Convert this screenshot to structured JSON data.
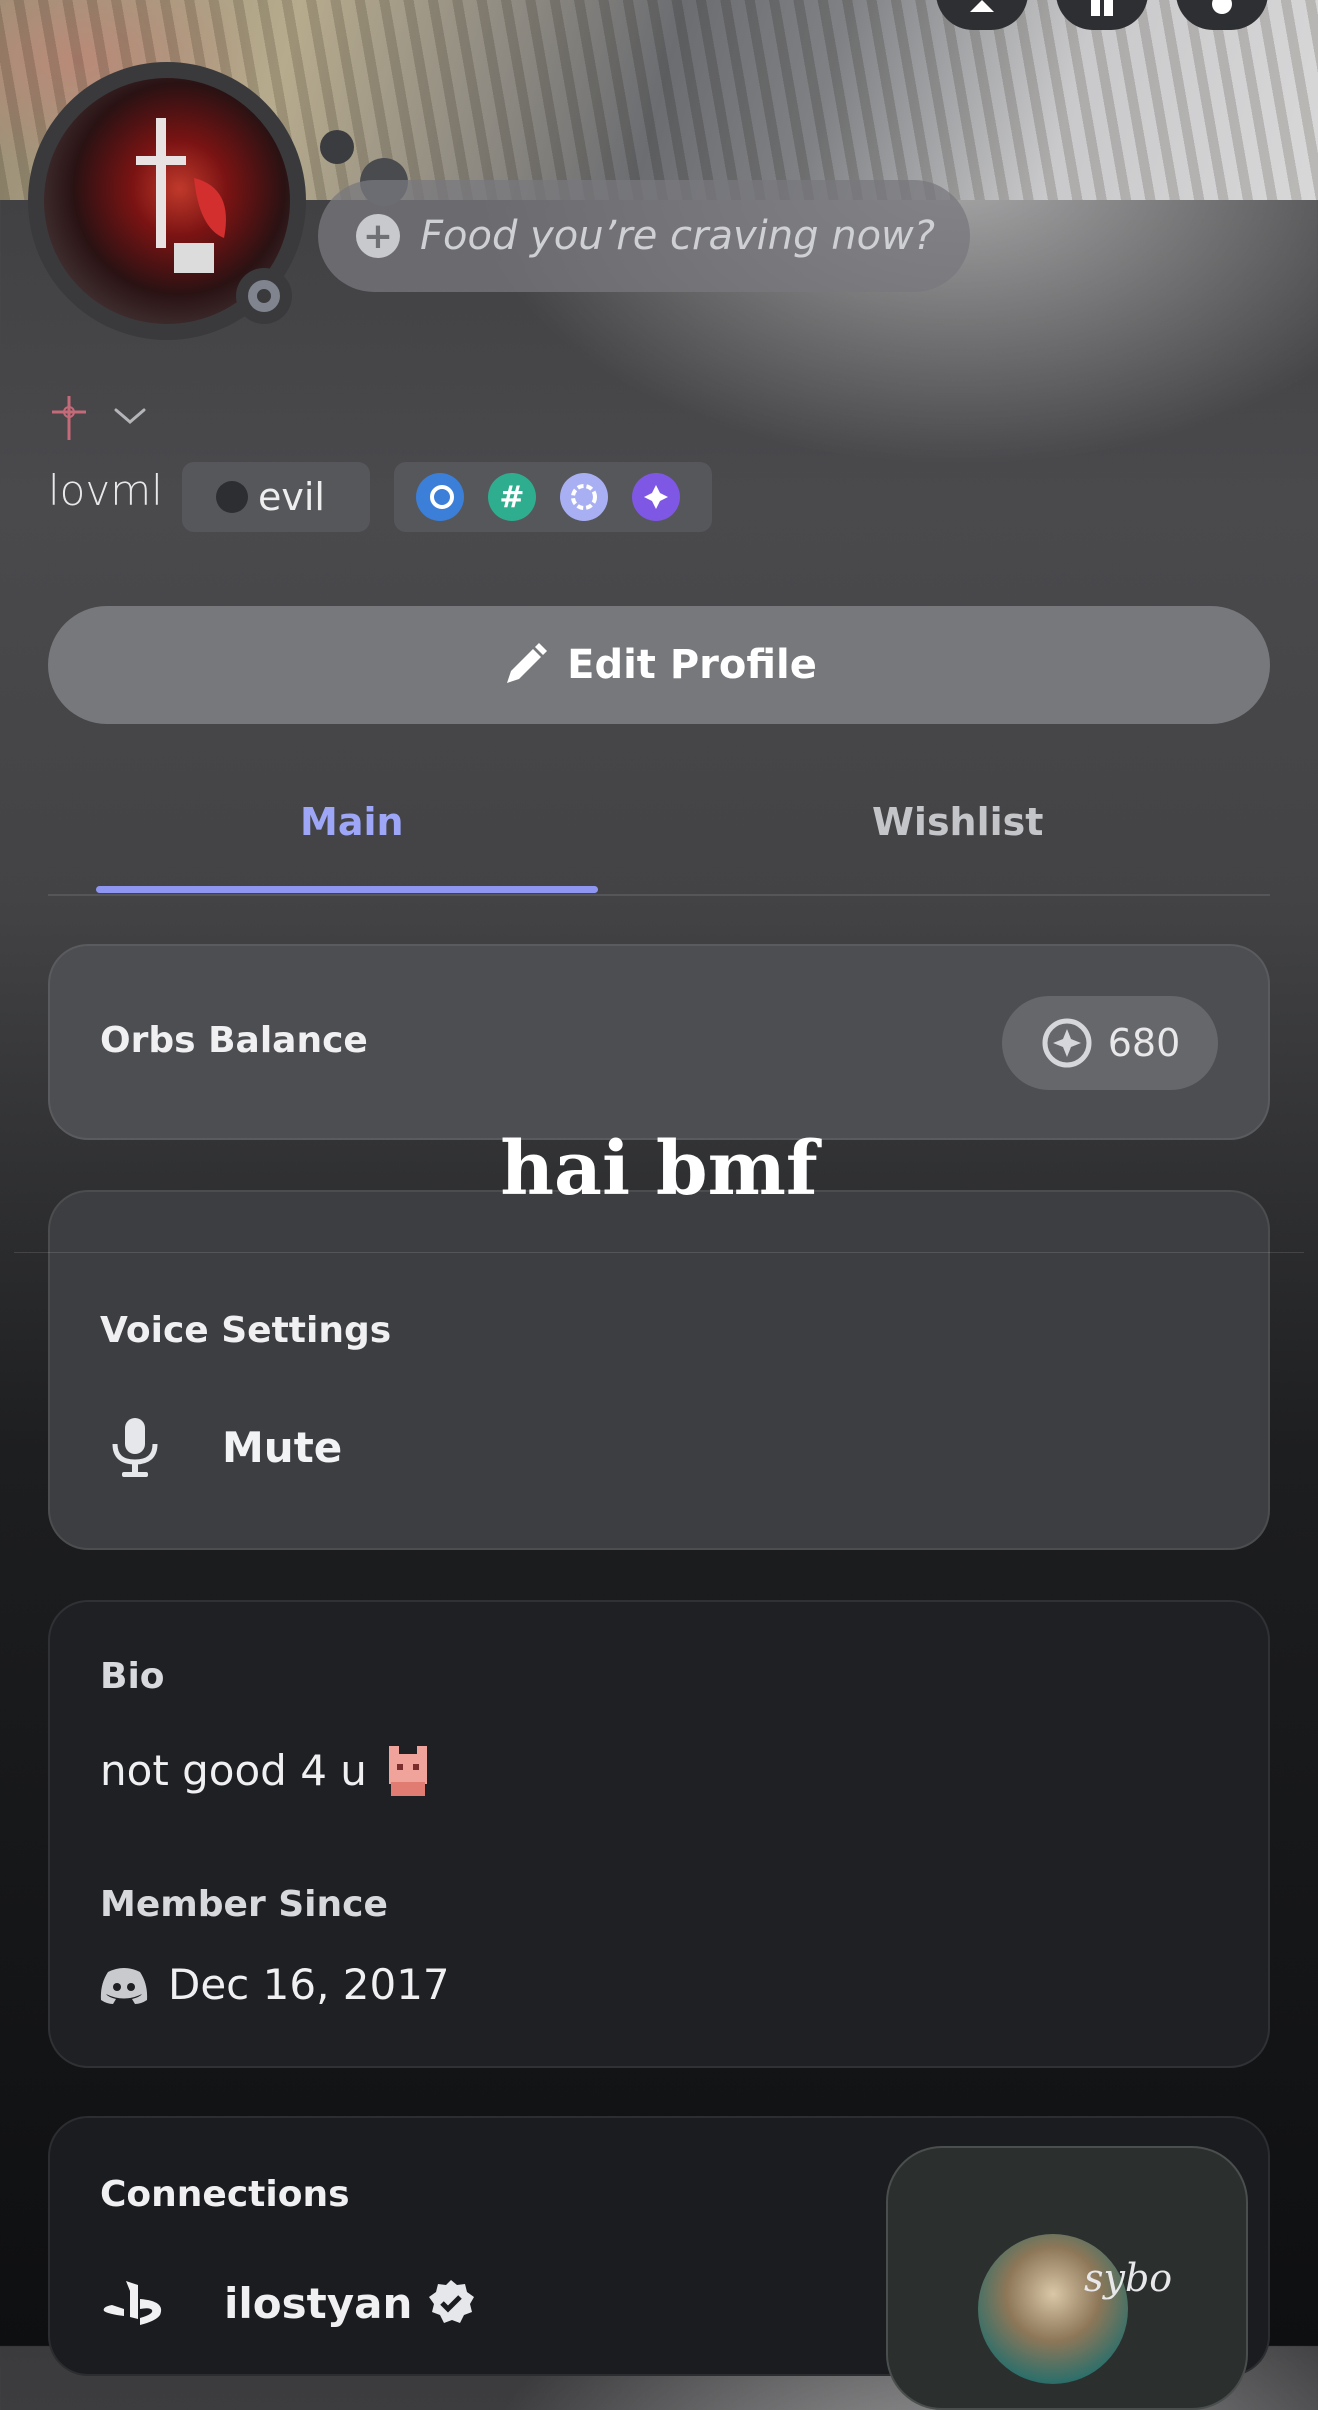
{
  "header": {
    "status_placeholder": "Food you’re craving now?",
    "add_status_symbol": "+"
  },
  "profile": {
    "username": "lovml",
    "tag": "evil",
    "status": "offline"
  },
  "buttons": {
    "edit_profile": "Edit Profile"
  },
  "tabs": [
    {
      "label": "Main",
      "active": true
    },
    {
      "label": "Wishlist",
      "active": false
    }
  ],
  "orbs": {
    "title": "Orbs Balance",
    "value": "680"
  },
  "overlay_caption": "hai bmf",
  "voice": {
    "title": "Voice Settings",
    "mute_label": "Mute"
  },
  "bio": {
    "title": "Bio",
    "text": "not good 4 u"
  },
  "member_since": {
    "title": "Member Since",
    "date": "Dec 16, 2017"
  },
  "connections": {
    "title": "Connections",
    "account_name": "ilostyan",
    "activity_text": "sybo"
  },
  "colors": {
    "accent": "#9ea7f7",
    "tab_underline": "#8e96f2",
    "card_bg": "#4d4e51"
  }
}
